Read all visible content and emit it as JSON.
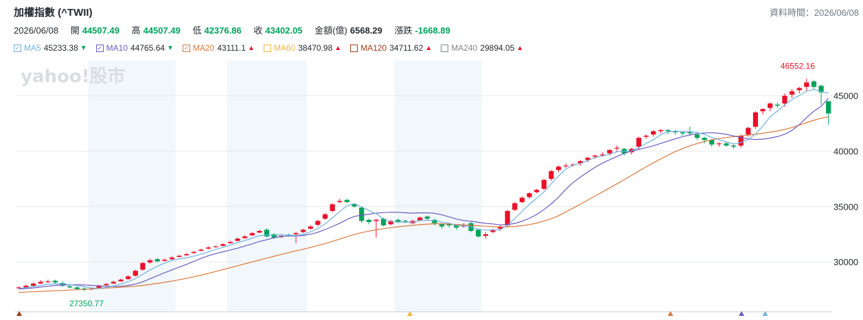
{
  "header": {
    "title": "加權指數 (^TWII)",
    "as_of": "資料時間：2026/06/08"
  },
  "ohlc": {
    "date": "2026/06/08",
    "open_label": "開",
    "open": "44507.49",
    "high_label": "高",
    "high": "44507.49",
    "low_label": "低",
    "low": "42376.86",
    "close_label": "收",
    "close": "43402.05",
    "amount_label": "金額(億)",
    "amount": "6568.29",
    "change_label": "漲跌",
    "change": "-1668.89"
  },
  "moving_averages": [
    {
      "name": "MA5",
      "value": "45233.38",
      "trend": "down",
      "color": "#6fb1de",
      "checked": true
    },
    {
      "name": "MA10",
      "value": "44765.64",
      "trend": "down",
      "color": "#6a5bbf",
      "checked": true
    },
    {
      "name": "MA20",
      "value": "43111.1",
      "trend": "up",
      "color": "#d8783a",
      "checked": true
    },
    {
      "name": "MA60",
      "value": "38470.98",
      "trend": "up",
      "color": "#f0b542",
      "checked": false
    },
    {
      "name": "MA120",
      "value": "34711.62",
      "trend": "up",
      "color": "#9a3b17",
      "checked": false
    },
    {
      "name": "MA240",
      "value": "29894.05",
      "trend": "up",
      "color": "#7d858d",
      "checked": false
    }
  ],
  "icons": {
    "checked": "check-icon",
    "trend_up": "triangle-up-icon",
    "trend_down": "triangle-down-icon"
  },
  "colors": {
    "up": "#eb0f29",
    "down": "#00a35a",
    "grid": "#e6e8ea",
    "band": "#f2f7fb"
  },
  "watermark": "yahoo!股市",
  "chart_data": {
    "type": "candlestick",
    "ylim": [
      25500,
      48200
    ],
    "y_ticks": [
      30000,
      35000,
      40000,
      45000
    ],
    "annotations": [
      {
        "label": "46552.16",
        "kind": "max",
        "color": "#eb0f29"
      },
      {
        "label": "27350.77",
        "kind": "min",
        "color": "#00a35a"
      }
    ],
    "closes": [
      27700,
      27850,
      28050,
      28200,
      28250,
      28150,
      27850,
      27700,
      27550,
      27500,
      27600,
      27850,
      28000,
      28200,
      28400,
      28700,
      29200,
      29900,
      30150,
      30050,
      30200,
      30400,
      30550,
      30700,
      30900,
      31100,
      31300,
      31400,
      31600,
      31800,
      32100,
      32300,
      32600,
      32800,
      32300,
      32200,
      32350,
      32400,
      32600,
      32900,
      33200,
      33700,
      34300,
      35200,
      35500,
      35400,
      35000,
      33700,
      33600,
      33800,
      33300,
      33700,
      33600,
      33600,
      33700,
      34000,
      33900,
      33500,
      33200,
      33300,
      33100,
      33350,
      32800,
      32300,
      32500,
      32900,
      33200,
      34600,
      35300,
      35800,
      36200,
      36500,
      37400,
      38200,
      38600,
      38700,
      38800,
      39100,
      39400,
      39600,
      39700,
      40100,
      40300,
      39800,
      40200,
      41200,
      41400,
      41800,
      41900,
      41800,
      41700,
      41600,
      41600,
      41200,
      41000,
      40600,
      40700,
      40500,
      40400,
      41400,
      42100,
      43500,
      43800,
      44300,
      44100,
      45000,
      45400,
      45700,
      46200,
      45800,
      45300,
      43402
    ],
    "opens": [
      27650,
      27700,
      27850,
      28050,
      28200,
      28300,
      28100,
      27800,
      27700,
      27600,
      27550,
      27650,
      27900,
      28050,
      28250,
      28450,
      28750,
      29300,
      29950,
      30250,
      30100,
      30250,
      30450,
      30600,
      30800,
      31000,
      31200,
      31350,
      31450,
      31700,
      31900,
      32150,
      32400,
      32650,
      32900,
      32500,
      32250,
      32450,
      32500,
      32700,
      33000,
      33350,
      33900,
      34600,
      35400,
      35600,
      35200,
      34900,
      33800,
      33700,
      33900,
      33400,
      33800,
      33700,
      33500,
      33750,
      34100,
      33800,
      33400,
      33400,
      33300,
      33200,
      33500,
      32900,
      32350,
      32700,
      33000,
      33300,
      34700,
      35400,
      35850,
      36300,
      36600,
      37500,
      38300,
      38700,
      38800,
      38900,
      39200,
      39500,
      39700,
      39800,
      40300,
      40200,
      39900,
      40400,
      41300,
      41500,
      41800,
      41900,
      41800,
      41700,
      41700,
      41500,
      41200,
      41000,
      40700,
      40700,
      40500,
      40500,
      41500,
      42200,
      43600,
      43900,
      44200,
      44300,
      45100,
      45500,
      45800,
      46300,
      45900,
      44507
    ],
    "highs": [
      27800,
      27950,
      28150,
      28350,
      28400,
      28400,
      28250,
      27950,
      27800,
      27700,
      27700,
      27950,
      28100,
      28300,
      28500,
      28800,
      29300,
      30000,
      30300,
      30350,
      30300,
      30500,
      30650,
      30800,
      31000,
      31200,
      31400,
      31500,
      31700,
      31900,
      32200,
      32400,
      32700,
      32900,
      33050,
      32600,
      32450,
      32550,
      32700,
      33000,
      33300,
      33800,
      34400,
      35300,
      35700,
      35700,
      35300,
      35000,
      33900,
      33900,
      34000,
      33800,
      33900,
      33800,
      33800,
      34100,
      34200,
      33900,
      33500,
      33500,
      33400,
      33500,
      33600,
      33000,
      32700,
      33000,
      33300,
      34700,
      35400,
      35900,
      36300,
      36600,
      37500,
      38300,
      38700,
      38900,
      38900,
      39200,
      39500,
      39700,
      39900,
      40200,
      40500,
      40300,
      40300,
      41300,
      41500,
      41900,
      42000,
      42000,
      41900,
      41800,
      42200,
      41600,
      41300,
      41100,
      40800,
      40800,
      40600,
      41500,
      42200,
      43600,
      43900,
      44400,
      44400,
      45200,
      45600,
      45800,
      46552,
      46400,
      46000,
      44507
    ],
    "lows": [
      27550,
      27650,
      27800,
      28000,
      28100,
      28050,
      27750,
      27600,
      27450,
      27350.77,
      27450,
      27600,
      27850,
      28000,
      28200,
      28400,
      28700,
      29200,
      29850,
      29950,
      30050,
      30200,
      30400,
      30550,
      30750,
      30950,
      31150,
      31300,
      31400,
      31650,
      31850,
      32100,
      32350,
      32600,
      32200,
      32100,
      32150,
      32300,
      31700,
      32600,
      32900,
      33200,
      33800,
      34500,
      35300,
      35300,
      34900,
      33500,
      33400,
      32200,
      33200,
      33300,
      33500,
      33500,
      33400,
      33650,
      33800,
      33300,
      33000,
      33100,
      32900,
      33100,
      32700,
      32200,
      32100,
      32600,
      32800,
      33200,
      34600,
      35300,
      35700,
      36200,
      36500,
      37300,
      38100,
      38500,
      38600,
      38700,
      39000,
      39300,
      39500,
      39600,
      40000,
      39600,
      39700,
      40100,
      41100,
      41300,
      41600,
      41500,
      41500,
      41400,
      41400,
      41000,
      40700,
      40400,
      40400,
      40400,
      40200,
      40300,
      41300,
      42000,
      43300,
      43600,
      43900,
      44000,
      44800,
      45200,
      45400,
      45600,
      44200,
      42376.86
    ],
    "ma5": [
      27600,
      27680,
      27780,
      27880,
      27980,
      28030,
      28010,
      27950,
      27870,
      27760,
      27640,
      27620,
      27700,
      27830,
      28000,
      28220,
      28500,
      28880,
      29280,
      29620,
      29900,
      30140,
      30260,
      30380,
      30520,
      30700,
      30920,
      31120,
      31320,
      31520,
      31740,
      31940,
      32150,
      32380,
      32420,
      32430,
      32450,
      32420,
      32370,
      32490,
      32720,
      33010,
      33440,
      33980,
      34540,
      35060,
      35260,
      34970,
      34640,
      34350,
      33880,
      33620,
      33600,
      33600,
      33580,
      33760,
      33760,
      33740,
      33600,
      33500,
      33280,
      33290,
      33150,
      32940,
      32870,
      32870,
      32900,
      33320,
      33920,
      34560,
      35210,
      35740,
      36320,
      37060,
      37780,
      38380,
      38740,
      38900,
      39140,
      39420,
      39560,
      39720,
      39940,
      40000,
      40020,
      40320,
      40700,
      41040,
      41480,
      41740,
      41800,
      41790,
      41770,
      41680,
      41510,
      41240,
      41020,
      40840,
      40650,
      40780,
      41060,
      41560,
      42270,
      43100,
      43620,
      44180,
      44660,
      45020,
      45420,
      45560,
      45380,
      45233.38
    ],
    "ma10": [
      27550,
      27600,
      27660,
      27730,
      27800,
      27880,
      27920,
      27940,
      27940,
      27920,
      27880,
      27840,
      27810,
      27790,
      27800,
      27880,
      28000,
      28200,
      28480,
      28760,
      29020,
      29280,
      29530,
      29780,
      30050,
      30320,
      30560,
      30750,
      30910,
      31070,
      31240,
      31430,
      31630,
      31850,
      32010,
      32180,
      32290,
      32350,
      32340,
      32390,
      32500,
      32680,
      32920,
      33200,
      33490,
      33830,
      34110,
      34220,
      34310,
      34400,
      34450,
      34490,
      34480,
      34440,
      34400,
      34430,
      34430,
      34390,
      34260,
      34060,
      33870,
      33740,
      33670,
      33580,
      33480,
      33430,
      33340,
      33380,
      33470,
      33670,
      33940,
      34280,
      34730,
      35240,
      35840,
      36560,
      37180,
      37660,
      38120,
      38550,
      38910,
      39220,
      39530,
      39800,
      40010,
      40150,
      40310,
      40490,
      40700,
      40910,
      41120,
      41310,
      41460,
      41580,
      41640,
      41660,
      41610,
      41520,
      41380,
      41230,
      41110,
      41050,
      41080,
      41180,
      41310,
      41520,
      41880,
      42390,
      43030,
      43600,
      44050,
      44765.64
    ],
    "ma20": [
      27250,
      27280,
      27310,
      27340,
      27370,
      27400,
      27430,
      27460,
      27490,
      27520,
      27560,
      27600,
      27640,
      27680,
      27720,
      27760,
      27810,
      27880,
      27970,
      28060,
      28160,
      28270,
      28390,
      28520,
      28660,
      28810,
      28970,
      29140,
      29310,
      29480,
      29650,
      29830,
      30000,
      30170,
      30340,
      30510,
      30680,
      30840,
      31000,
      31150,
      31310,
      31480,
      31660,
      31860,
      32060,
      32280,
      32480,
      32640,
      32780,
      32900,
      33000,
      33090,
      33170,
      33240,
      33300,
      33360,
      33410,
      33440,
      33440,
      33420,
      33380,
      33340,
      33300,
      33260,
      33220,
      33190,
      33160,
      33170,
      33200,
      33270,
      33370,
      33510,
      33690,
      33900,
      34170,
      34510,
      34860,
      35210,
      35580,
      35950,
      36310,
      36680,
      37050,
      37430,
      37810,
      38200,
      38580,
      38940,
      39300,
      39640,
      39960,
      40230,
      40480,
      40690,
      40870,
      41020,
      41140,
      41230,
      41310,
      41380,
      41450,
      41520,
      41610,
      41710,
      41820,
      41960,
      42130,
      42340,
      42570,
      42790,
      42970,
      43111.1
    ],
    "bands": [
      [
        10,
        22
      ],
      [
        29,
        40
      ],
      [
        52,
        64
      ]
    ],
    "markers": [
      {
        "i": 0,
        "color": "#9a3b17"
      },
      {
        "i": 33,
        "color": "#f0b542"
      },
      {
        "i": 55,
        "color": "#d8783a"
      },
      {
        "i": 61,
        "color": "#6a5bbf"
      },
      {
        "i": 63,
        "color": "#6fb1de"
      }
    ]
  }
}
